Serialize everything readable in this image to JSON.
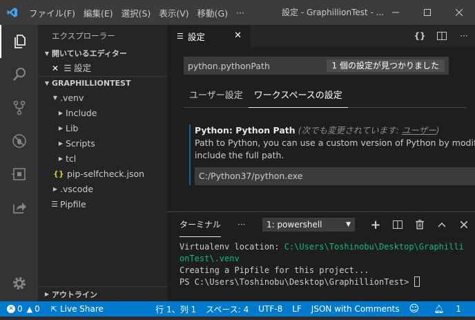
{
  "titlebar": {
    "menu": [
      "ファイル(F)",
      "編集(E)",
      "選択(S)",
      "表示(V)",
      "移動(G)",
      "···"
    ],
    "title": "設定 - GraphillionTest - ..."
  },
  "sidebar": {
    "header": "エクスプローラー",
    "open_editors": {
      "title": "開いているエディター",
      "items": [
        {
          "label": "設定"
        }
      ]
    },
    "folder": {
      "title": "GRAPHILLIONTEST",
      "tree": [
        {
          "label": ".venv",
          "expanded": true
        },
        {
          "label": "Include"
        },
        {
          "label": "Lib"
        },
        {
          "label": "Scripts"
        },
        {
          "label": "tcl"
        },
        {
          "label": "pip-selfcheck.json"
        },
        {
          "label": ".vscode"
        },
        {
          "label": "Pipfile"
        }
      ]
    },
    "outline": "アウトライン"
  },
  "editor": {
    "tab": {
      "label": "設定"
    },
    "search": {
      "value": "python.pythonPath",
      "result_badge": "1 個の設定が見つかりました"
    },
    "scopes": [
      "ユーザー設定",
      "ワークスペースの設定"
    ],
    "setting": {
      "category": "Python: ",
      "name": "Python Path",
      "modified_note": "(次でも変更されています: ",
      "modified_link": "ユーザー",
      "modified_close": ")",
      "description_line1": "Path to Python, you can use a custom version of Python by modifying this setting to",
      "description_line2": "include the full path.",
      "value": "C:/Python37/python.exe"
    }
  },
  "panel": {
    "tab": "ターミナル",
    "more": "···",
    "terminal_select": "1: powershell",
    "lines": {
      "l1_prefix": "Virtualenv location: ",
      "l1_path": "C:\\Users\\Toshinobu\\Desktop\\Graphilli",
      "l2_path": "onTest\\.venv",
      "l3": "Creating a Pipfile for this project...",
      "l4_prompt": "PS C:\\Users\\Toshinobu\\Desktop\\GraphillionTest> "
    }
  },
  "status": {
    "errors": "0",
    "warnings": "0",
    "live_share": "Live Share",
    "position": "行 1、列 1",
    "spaces": "スペース: 4",
    "encoding": "UTF-8",
    "eol": "LF",
    "language": "JSON with Comments",
    "notifications": "1"
  },
  "colors": {
    "accent": "#007acc",
    "terminal_green": "#0dbc79"
  }
}
